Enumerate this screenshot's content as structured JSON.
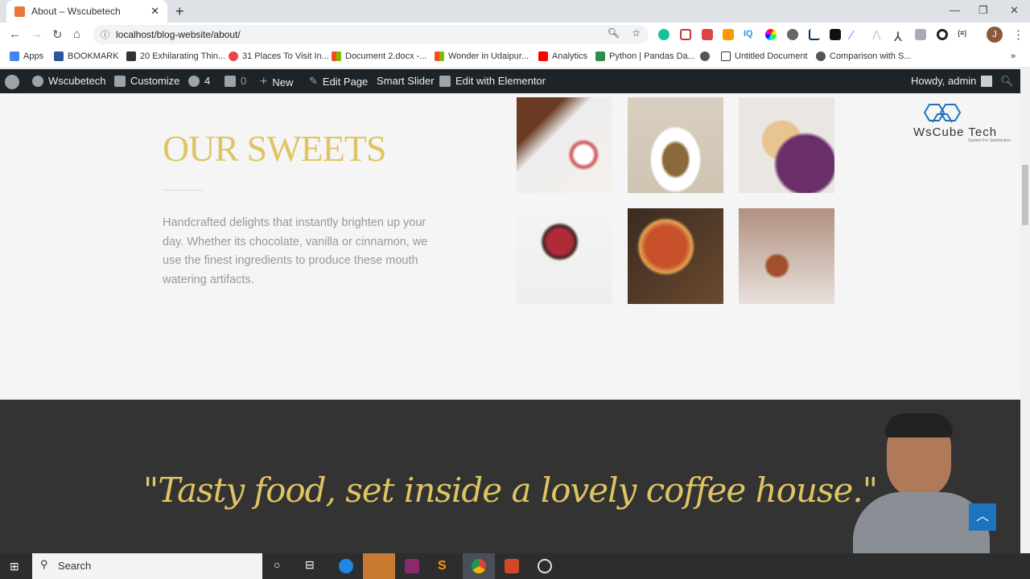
{
  "browser": {
    "tab_title": "About – Wscubetech",
    "url": "localhost/blog-website/about/",
    "profile_initial": "J"
  },
  "bookmarks": [
    {
      "label": "Apps",
      "color": "#4285f4"
    },
    {
      "label": "BOOKMARK",
      "color": "#2b579a"
    },
    {
      "label": "20 Exhilarating Thin...",
      "color": "#333"
    },
    {
      "label": "31 Places To Visit In...",
      "color": "#e44"
    },
    {
      "label": "Document 2.docx -...",
      "color": "#f25022"
    },
    {
      "label": "Wonder in Udaipur...",
      "color": "#f25022"
    },
    {
      "label": "Analytics",
      "color": "#f00"
    },
    {
      "label": "Python | Pandas Da...",
      "color": "#2f8d46"
    },
    {
      "label": "Untitled Document",
      "color": "#555"
    },
    {
      "label": "Comparison with S...",
      "color": "#555"
    }
  ],
  "wpbar": {
    "site": "Wscubetech",
    "customize": "Customize",
    "updates": "4",
    "comments": "0",
    "new": "New",
    "edit_page": "Edit Page",
    "smart_slider": "Smart Slider",
    "elementor": "Edit with Elementor",
    "howdy": "Howdy, admin"
  },
  "section": {
    "title": "OUR SWEETS",
    "description": "Handcrafted delights that instantly brighten up your day. Whether its chocolate, vanilla or cinnamon, we use the finest ingredients to produce these mouth watering artifacts."
  },
  "logo": {
    "name": "WsCube Tech",
    "tagline": "System For Satisfaction"
  },
  "quote": "\"Tasty food, set inside a lovely coffee house.\"",
  "taskbar": {
    "search": "Search"
  },
  "colors": {
    "accent": "#e0c463",
    "dark": "#333333",
    "wpbar": "#1d2327"
  }
}
